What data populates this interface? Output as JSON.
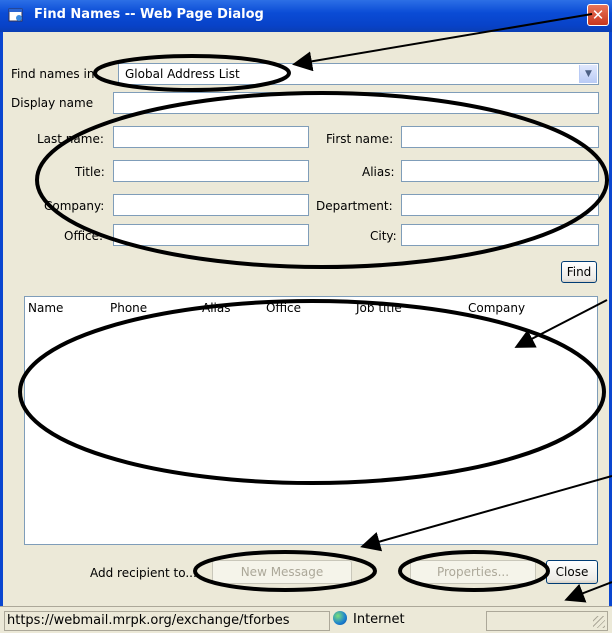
{
  "window": {
    "title": "Find Names -- Web Page Dialog",
    "close_label": "✕"
  },
  "form": {
    "find_names_in_label": "Find names in:",
    "address_list_value": "Global Address List",
    "display_name_label": "Display name",
    "last_name_label": "Last name:",
    "first_name_label": "First name:",
    "title_label": "Title:",
    "alias_label": "Alias:",
    "company_label": "Company:",
    "department_label": "Department:",
    "office_label": "Office:",
    "city_label": "City:",
    "find_button": "Find"
  },
  "results": {
    "columns": [
      "Name",
      "Phone",
      "Alias",
      "Office",
      "Job title",
      "Company"
    ]
  },
  "footer": {
    "add_recipient_label": "Add recipient to...",
    "new_message_button": "New Message",
    "properties_button": "Properties...",
    "close_button": "Close"
  },
  "statusbar": {
    "url": "https://webmail.mrpk.org/exchange/tforbes",
    "zone": "Internet"
  },
  "colors": {
    "titlebar": "#0A4CD6",
    "annotation": "#000000"
  },
  "icons": [
    "dialog-icon",
    "close-icon",
    "chevron-down-icon",
    "globe-icon",
    "resize-grip-icon"
  ]
}
